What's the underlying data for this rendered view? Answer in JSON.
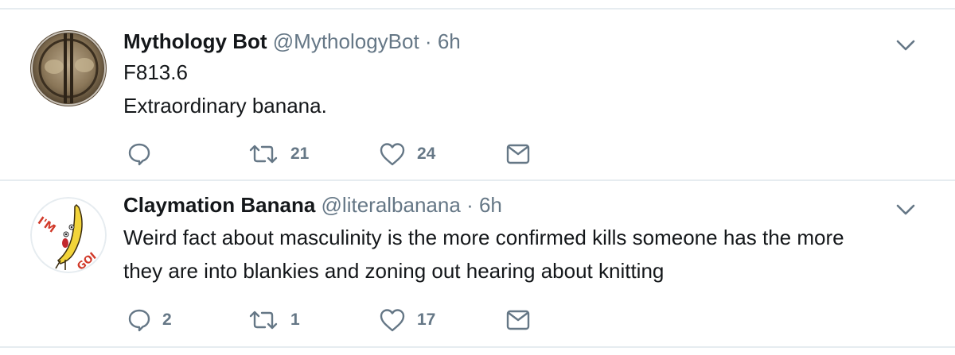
{
  "tweets": [
    {
      "name": "Mythology Bot",
      "handle": "@MythologyBot",
      "separator": "·",
      "time": "6h",
      "lines": [
        "F813.6",
        "Extraordinary banana."
      ],
      "actions": {
        "reply": {
          "icon": "reply-icon",
          "count": ""
        },
        "retweet": {
          "icon": "retweet-icon",
          "count": "21"
        },
        "like": {
          "icon": "heart-icon",
          "count": "24"
        },
        "dm": {
          "icon": "envelope-icon",
          "count": ""
        }
      }
    },
    {
      "name": "Claymation Banana",
      "handle": "@literalbanana",
      "separator": "·",
      "time": "6h",
      "lines": [
        "Weird fact about masculinity is the more confirmed kills someone has the more",
        "they are into blankies and zoning out hearing about knitting"
      ],
      "avatar_text": "I'M GOIN'",
      "actions": {
        "reply": {
          "icon": "reply-icon",
          "count": "2"
        },
        "retweet": {
          "icon": "retweet-icon",
          "count": "1"
        },
        "like": {
          "icon": "heart-icon",
          "count": "17"
        },
        "dm": {
          "icon": "envelope-icon",
          "count": ""
        }
      }
    }
  ],
  "colors": {
    "text": "#14171a",
    "secondary": "#657786",
    "divider": "#e6ecf0",
    "banana": "#f2d43a"
  }
}
